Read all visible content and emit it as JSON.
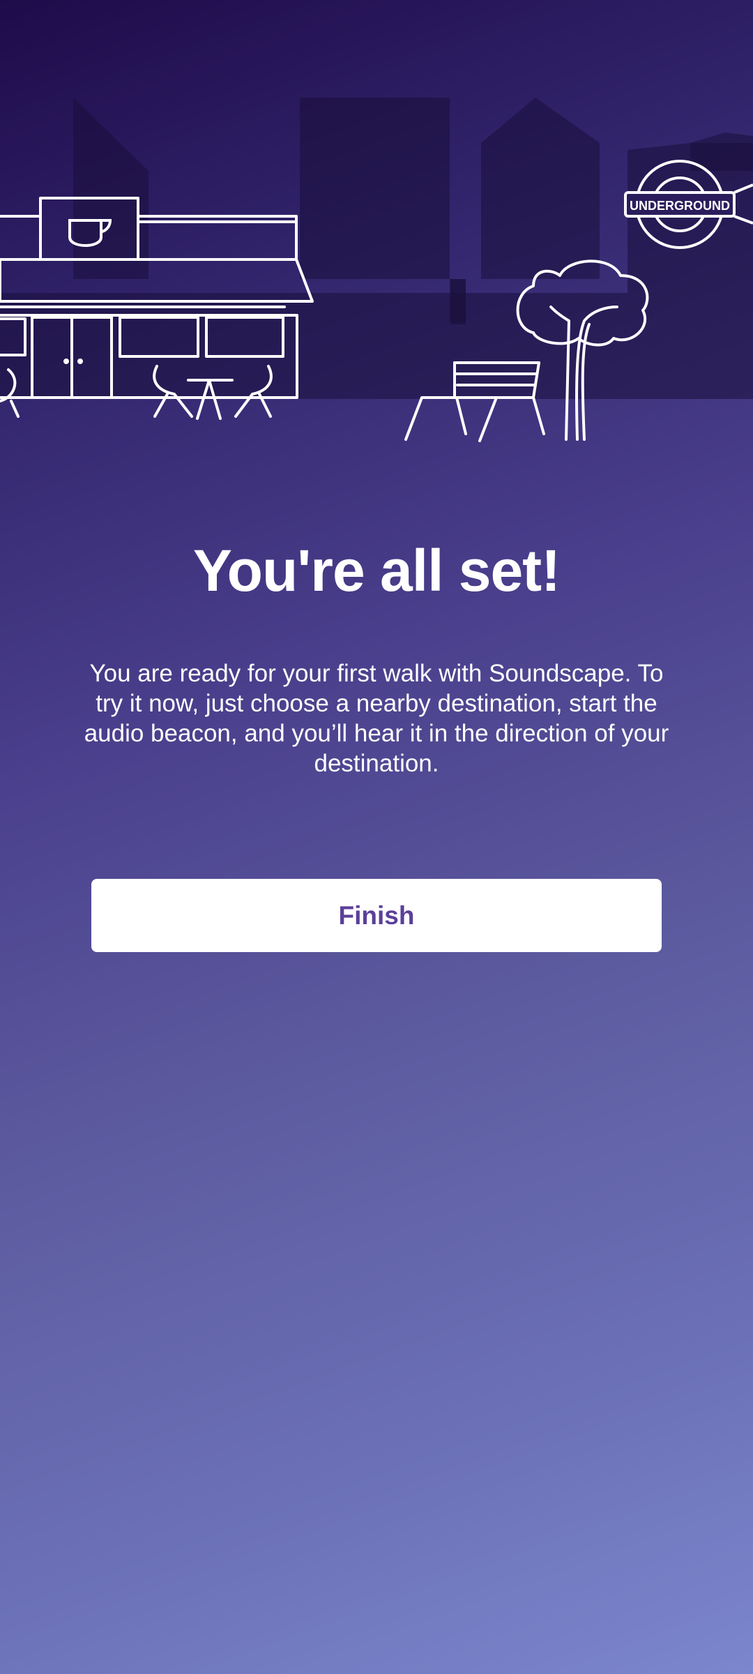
{
  "onboarding": {
    "title": "You're all set!",
    "description": "You are ready for your first walk with Soundscape. To try it now, just choose a nearby destination, start the audio beacon, and you’ll hear it in the direction of your destination.",
    "finish_label": "Finish"
  },
  "illustration": {
    "sign_text": "UNDERGROUND",
    "icons": [
      "coffee-cup-icon",
      "underground-sign-icon",
      "tree-icon",
      "bench-icon"
    ]
  },
  "colors": {
    "gradient_top": "#1e0b4a",
    "gradient_bottom": "#7b86cc",
    "button_background": "#ffffff",
    "button_text": "#5b3f9a",
    "line_art": "#ffffff"
  }
}
